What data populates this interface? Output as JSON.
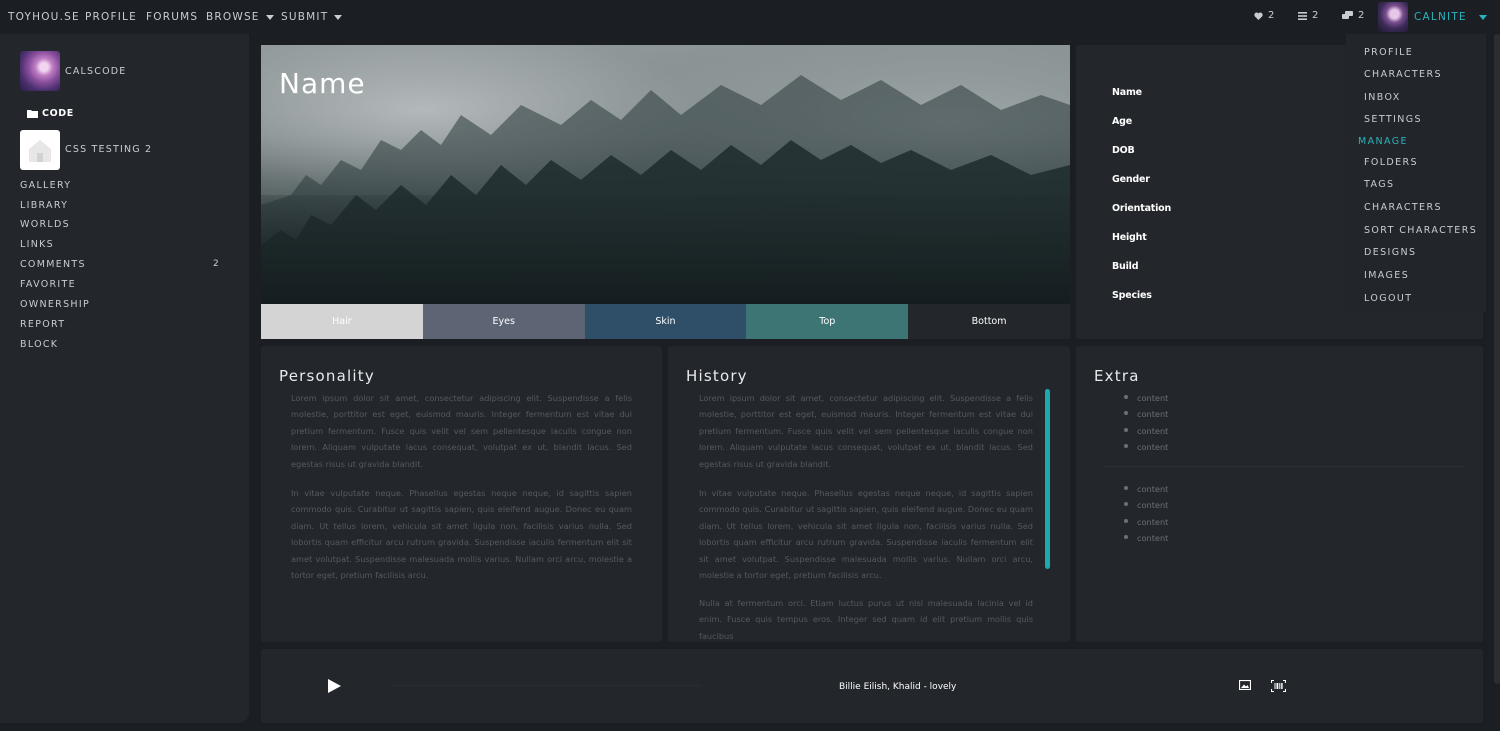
{
  "topnav": {
    "brand": "TOYHOU.SE",
    "links": [
      "PROFILE",
      "FORUMS",
      "BROWSE",
      "SUBMIT"
    ],
    "counters": {
      "favorites": "2",
      "notifications": "2",
      "messages": "2"
    },
    "username": "CALNITE"
  },
  "dropdown": {
    "items_top": [
      "PROFILE",
      "CHARACTERS",
      "INBOX",
      "SETTINGS"
    ],
    "manage_header": "MANAGE",
    "items_manage": [
      "FOLDERS",
      "TAGS",
      "CHARACTERS",
      "SORT CHARACTERS",
      "DESIGNS",
      "IMAGES",
      "LOGOUT"
    ]
  },
  "sidebar": {
    "owner": "CALSCODE",
    "folder": "CODE",
    "character": "CSS TESTING 2",
    "links": [
      "GALLERY",
      "LIBRARY",
      "WORLDS",
      "LINKS",
      "COMMENTS",
      "FAVORITE",
      "OWNERSHIP",
      "REPORT",
      "BLOCK"
    ],
    "comments_count": "2"
  },
  "hero": {
    "title": "Name"
  },
  "swatches": [
    {
      "label": "Hair",
      "color": "#d4d4d4"
    },
    {
      "label": "Eyes",
      "color": "#5d6473"
    },
    {
      "label": "Skin",
      "color": "#2e4f67"
    },
    {
      "label": "Top",
      "color": "#3d7575"
    },
    {
      "label": "Bottom",
      "color": "#23262b"
    }
  ],
  "stats": [
    "Name",
    "Age",
    "DOB",
    "Gender",
    "Orientation",
    "Height",
    "Build",
    "Species"
  ],
  "personality": {
    "title": "Personality",
    "p1": "Lorem ipsum dolor sit amet, consectetur adipiscing elit. Suspendisse a felis molestie, porttitor est eget, euismod mauris. Integer fermentum est vitae dui pretium fermentum. Fusce quis velit vel sem pellentesque iaculis congue non lorem. Aliquam vulputate lacus consequat, volutpat ex ut, blandit lacus. Sed egestas risus ut gravida blandit.",
    "p2": "In vitae vulputate neque. Phasellus egestas neque neque, id sagittis sapien commodo quis. Curabitur ut sagittis sapien, quis eleifend augue. Donec eu quam diam. Ut tellus lorem, vehicula sit amet ligula non, facilisis varius nulla. Sed lobortis quam efficitur arcu rutrum gravida. Suspendisse iaculis fermentum elit sit amet volutpat. Suspendisse malesuada mollis varius. Nullam orci arcu, molestie a tortor eget, pretium facilisis arcu."
  },
  "history": {
    "title": "History",
    "p1": "Lorem ipsum dolor sit amet, consectetur adipiscing elit. Suspendisse a felis molestie, porttitor est eget, euismod mauris. Integer fermentum est vitae dui pretium fermentum. Fusce quis velit vel sem pellentesque iaculis congue non lorem. Aliquam vulputate lacus consequat, volutpat ex ut, blandit lacus. Sed egestas risus ut gravida blandit.",
    "p2": "In vitae vulputate neque. Phasellus egestas neque neque, id sagittis sapien commodo quis. Curabitur ut sagittis sapien, quis eleifend augue. Donec eu quam diam. Ut tellus lorem, vehicula sit amet ligula non, facilisis varius nulla. Sed lobortis quam efficitur arcu rutrum gravida. Suspendisse iaculis fermentum elit sit amet volutpat. Suspendisse malesuada mollis varius. Nullam orci arcu, molestie a tortor eget, pretium facilisis arcu.",
    "p3": "Nulla at fermentum orci. Etiam luctus purus ut nisl malesuada lacinia vel id enim. Fusce quis tempus eros. Integer sed quam id elit pretium mollis quis faucibus"
  },
  "extra": {
    "title": "Extra",
    "list1": [
      "content",
      "content",
      "content",
      "content"
    ],
    "list2": [
      "content",
      "content",
      "content",
      "content"
    ]
  },
  "player": {
    "track": "Billie Eilish, Khalid - lovely"
  },
  "colors": {
    "accent": "#2bb3bd",
    "card": "#23262b",
    "background": "#1b1e22"
  },
  "icons": [
    "heart-icon",
    "list-icon",
    "chat-icon",
    "folder-icon",
    "house-icon",
    "play-icon",
    "image-icon",
    "barcode-icon"
  ]
}
